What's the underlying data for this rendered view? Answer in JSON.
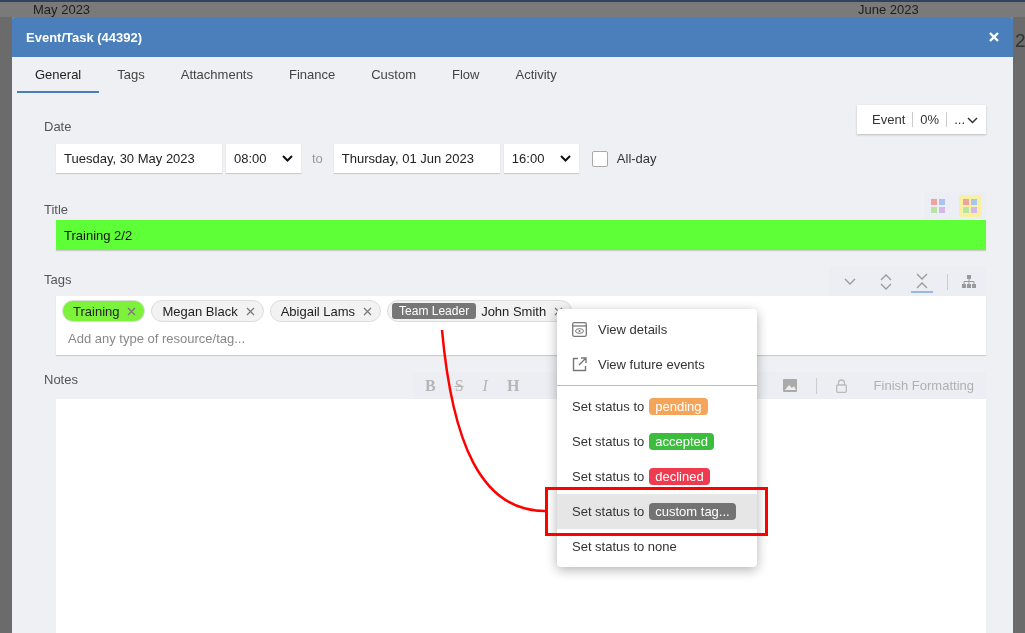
{
  "backdrop": {
    "month_left": "May 2023",
    "month_right": "June 2023",
    "edge_text": "2"
  },
  "dialog": {
    "title": "Event/Task (44392)"
  },
  "tabs": [
    {
      "label": "General",
      "selected": true
    },
    {
      "label": "Tags",
      "selected": false
    },
    {
      "label": "Attachments",
      "selected": false
    },
    {
      "label": "Finance",
      "selected": false
    },
    {
      "label": "Custom",
      "selected": false
    },
    {
      "label": "Flow",
      "selected": false
    },
    {
      "label": "Activity",
      "selected": false
    }
  ],
  "type_selector": {
    "type": "Event",
    "progress": "0%",
    "more": "..."
  },
  "date": {
    "label": "Date",
    "start_date": "Tuesday, 30 May 2023",
    "start_time": "08:00",
    "separator": "to",
    "end_date": "Thursday, 01 Jun 2023",
    "end_time": "16:00",
    "all_day": {
      "label": "All-day",
      "checked": false
    }
  },
  "title_field": {
    "label": "Title",
    "value": "Training 2/2",
    "color": "#5fff37"
  },
  "tags": {
    "label": "Tags",
    "placeholder": "Add any type of resource/tag...",
    "view_modes": [
      {
        "kind": "down",
        "selected": false
      },
      {
        "kind": "expand",
        "selected": false
      },
      {
        "kind": "collapse",
        "selected": true
      }
    ],
    "items": [
      {
        "label": "Training",
        "color": "#7cf23a"
      },
      {
        "label": "Megan Black",
        "color": "#f2f2f2"
      },
      {
        "label": "Abigail Lams",
        "color": "#f2f2f2"
      },
      {
        "role": "Team Leader",
        "label": "John Smith",
        "color": "#f2f2f2"
      }
    ]
  },
  "notes": {
    "label": "Notes",
    "format_buttons": [
      {
        "kind": "bold",
        "label": "B"
      },
      {
        "kind": "strike",
        "label": "S"
      },
      {
        "kind": "italic",
        "label": "I"
      },
      {
        "kind": "heading",
        "label": "H"
      }
    ],
    "finish": "Finish Formatting"
  },
  "context_menu": {
    "actions": [
      {
        "kind": "view",
        "label": "View details"
      },
      {
        "kind": "external",
        "label": "View future events"
      }
    ],
    "statuses": [
      {
        "prefix": "Set status to",
        "badge": "pending",
        "color": "#f5a55a",
        "selected": false
      },
      {
        "prefix": "Set status to",
        "badge": "accepted",
        "color": "#3dbd3d",
        "selected": false
      },
      {
        "prefix": "Set status to",
        "badge": "declined",
        "color": "#ef3b4f",
        "selected": false
      },
      {
        "prefix": "Set status to",
        "badge": "custom tag...",
        "color": "#737373",
        "selected": true
      },
      {
        "prefix": "Set status to none",
        "selected": false
      }
    ]
  }
}
